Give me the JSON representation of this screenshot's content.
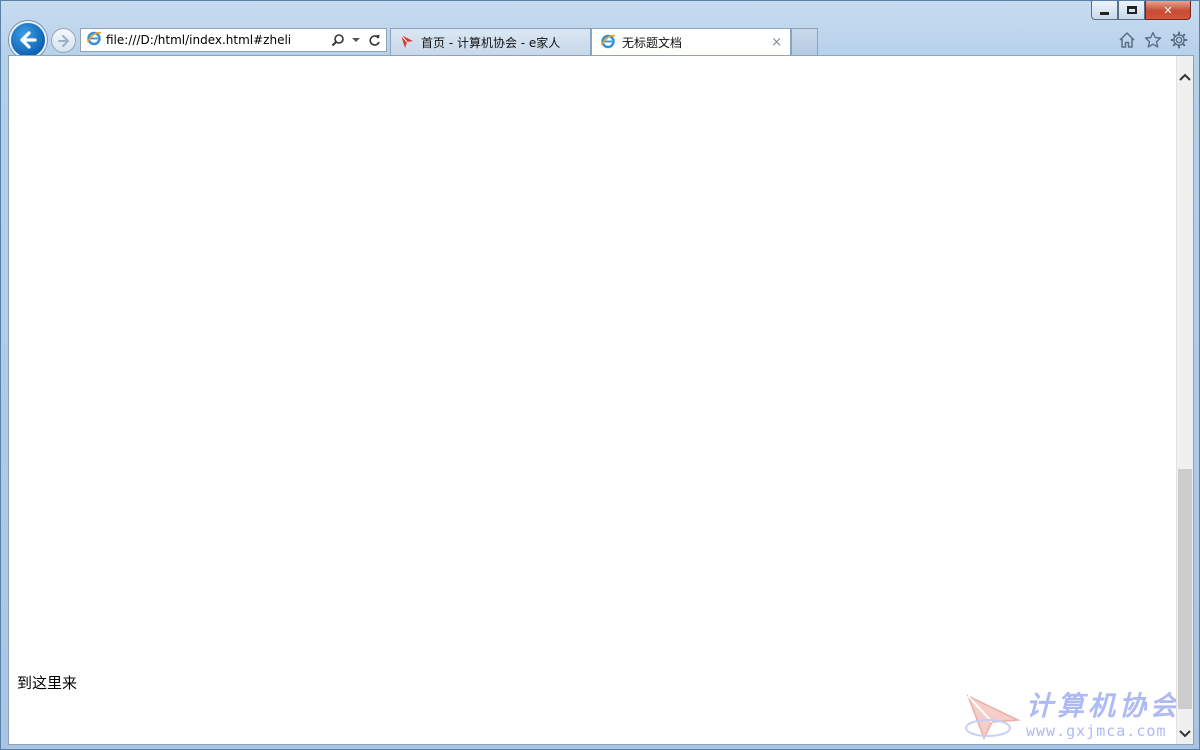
{
  "window": {
    "caption_minimize": "minimize",
    "caption_maximize": "maximize",
    "caption_close": "✕"
  },
  "address_bar": {
    "url": "file:///D:/html/index.html#zheli",
    "icons": [
      "ie-icon",
      "search-icon",
      "dropdown-icon",
      "refresh-icon"
    ]
  },
  "tabs": [
    {
      "title": "首页 - 计算机协会 - e家人",
      "icon": "site-icon",
      "active": false
    },
    {
      "title": "无标题文档",
      "icon": "ie-icon",
      "active": true,
      "close": "×"
    }
  ],
  "toolbar_icons": [
    "home-icon",
    "favorites-icon",
    "settings-icon"
  ],
  "page": {
    "anchor_text": "到这里来"
  },
  "watermark": {
    "title": "计算机协会",
    "url": "www.gxjmca.com"
  },
  "colors": {
    "back_button": "#0d62b3",
    "close_button": "#c74a32",
    "watermark": "#9aa9f2"
  }
}
